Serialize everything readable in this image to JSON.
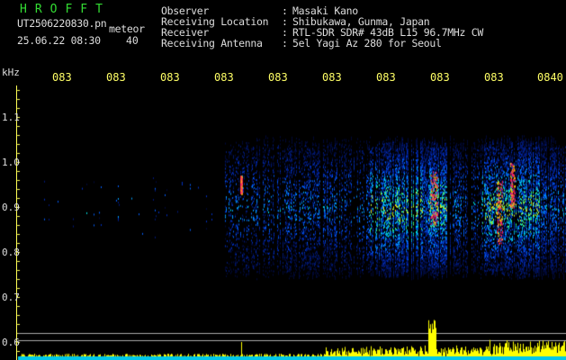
{
  "header": {
    "app_title": "HROFFT",
    "file_name": "UT2506220830.pn",
    "type_label": "meteor",
    "date_time": "25.06.22 08:30",
    "count": "40",
    "rows": [
      {
        "key": "Observer",
        "sep": ":",
        "value": "Masaki Kano"
      },
      {
        "key": "Receiving Location",
        "sep": ":",
        "value": "Shibukawa, Gunma, Japan"
      },
      {
        "key": "Receiver",
        "sep": ":",
        "value": "RTL-SDR SDR# 43dB L15 96.7MHz CW"
      },
      {
        "key": "Receiving Antenna",
        "sep": ":",
        "value": "5el Yagi Az 280 for Seoul"
      }
    ]
  },
  "axis": {
    "freq_unit": "kHz",
    "freq_ticks": [
      "1.1",
      "1.0",
      "0.9",
      "0.8",
      "0.7",
      "0.6"
    ],
    "time_ticks": [
      "083",
      "083",
      "083",
      "083",
      "083",
      "083",
      "083",
      "083",
      "083",
      "0840"
    ]
  },
  "colors": {
    "background": "#000000",
    "title": "#33dd33",
    "text": "#dddddd",
    "time_axis": "#ffff66",
    "spectrum": "#ffff00",
    "hotspot": "#ff2266"
  }
}
